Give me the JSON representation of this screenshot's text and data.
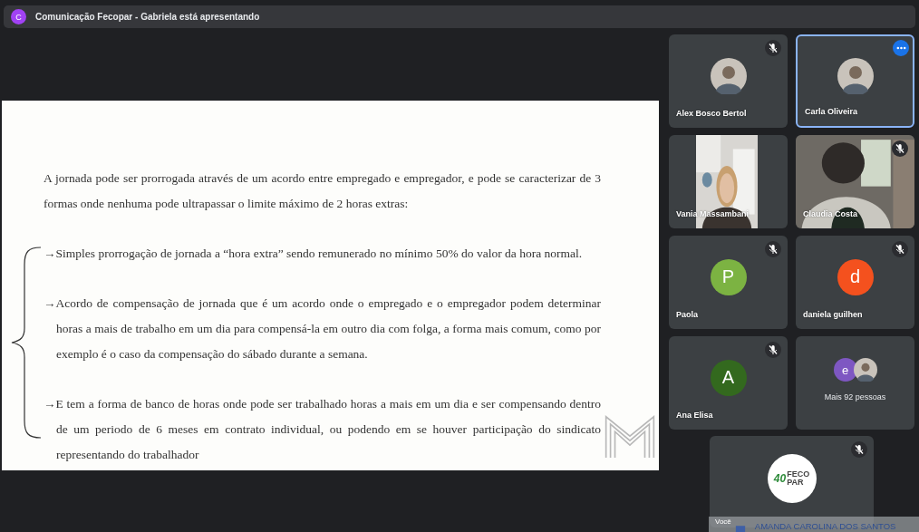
{
  "meeting": {
    "badge": "C",
    "title": "Comunicação Fecopar - Gabriela está apresentando"
  },
  "slide": {
    "intro": "A jornada pode ser prorrogada através de um acordo entre empregado e empregador, e pode se caracterizar de 3 formas onde nenhuma pode ultrapassar o limite máximo de 2 horas extras:",
    "items": [
      {
        "arrow": "→",
        "text": "Simples prorrogação de jornada a “hora extra”  sendo remunerado no mínimo 50% do valor da hora normal."
      },
      {
        "arrow": "→",
        "text": "Acordo de compensação de jornada que é um acordo onde o empregado e o empregador podem determinar horas a mais de trabalho em um dia para compensá-la em outro dia com folga, a forma mais comum, como por exemplo é o caso da compensação do sábado durante a semana."
      },
      {
        "arrow": "→",
        "text": "E tem a forma de banco de horas onde pode ser trabalhado horas a mais em um dia e ser compensando dentro de um periodo de 6 meses em contrato individual, ou podendo em se houver participação do sindicato representando do trabalhador"
      }
    ]
  },
  "participants": [
    {
      "name": "Alex Bosco Bertol",
      "muted": true,
      "hovered": false
    },
    {
      "name": "Carla Oliveira",
      "muted": false,
      "hovered": true
    },
    {
      "name": "Vania Massambani",
      "kind": "portrait",
      "muted": false,
      "hovered": false
    },
    {
      "name": "Claudia Costa",
      "kind": "video",
      "muted": true,
      "hovered": false
    },
    {
      "name": "Paola",
      "kind": "letter",
      "letter": "P",
      "color": "#7cb342",
      "muted": true,
      "hovered": false
    },
    {
      "name": "daniela guilhen",
      "kind": "letter",
      "letter": "d",
      "color": "#f4511e",
      "muted": true,
      "hovered": false
    },
    {
      "name": "Ana Elisa",
      "kind": "letter",
      "letter": "A",
      "color": "#33691e",
      "muted": true,
      "hovered": false
    },
    {
      "kind": "more",
      "letter": "e",
      "color": "#7e57c2",
      "label": "Mais 92 pessoas"
    }
  ],
  "self_tile": {
    "muted": true,
    "logo": {
      "number": "40",
      "line_1": "FECO",
      "line_2": "PAR"
    },
    "you_label": "Você",
    "name": "AMANDA CAROLINA DOS SANTOS"
  }
}
